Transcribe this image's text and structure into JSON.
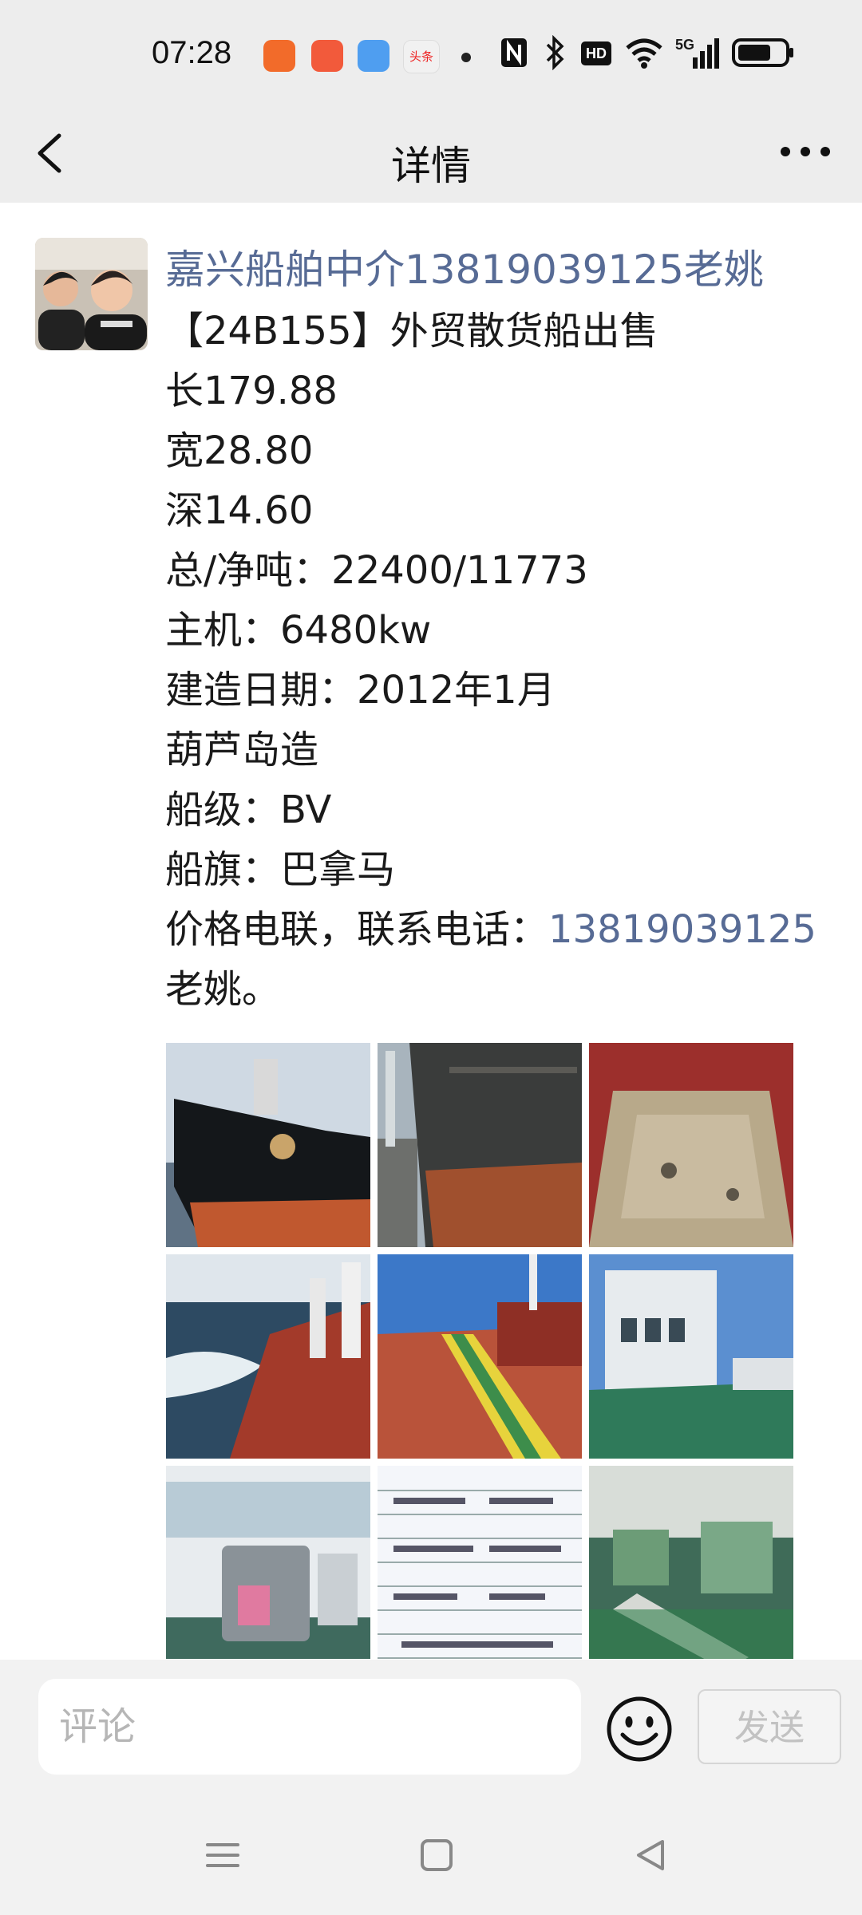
{
  "status_bar": {
    "time": "07:28",
    "badge_text": "头条",
    "network": "5G",
    "hd": "HD",
    "icons": [
      "app-icon-orange",
      "app-icon-red",
      "weather-icon",
      "news-app-icon",
      "dot-icon",
      "nfc-icon",
      "bluetooth-icon",
      "hd-icon",
      "wifi-icon",
      "signal-5g-icon",
      "battery-icon"
    ]
  },
  "nav": {
    "title": "详情",
    "back_icon": "back-chevron-icon",
    "more_icon": "more-dots-icon"
  },
  "post": {
    "author": "嘉兴船舶中介13819039125老姚",
    "lines": [
      "【24B155】外贸散货船出售",
      "长179.88",
      "宽28.80",
      "深14.60",
      "总/净吨：22400/11773",
      "主机：6480kw",
      "建造日期：2012年1月",
      "葫芦岛造",
      "船级：BV",
      "船旗：巴拿马"
    ],
    "contact_prefix": "价格电联，联系电话：",
    "contact_phone": "13819039125",
    "contact_suffix": "老姚。",
    "photos": [
      "ship-bow-photo",
      "ship-hull-side-photo",
      "cargo-hold-photo",
      "ship-at-sea-photo",
      "deck-walkway-photo",
      "superstructure-deck-photo",
      "bridge-interior-photo",
      "ship-particulars-sheet-photo",
      "engine-room-photo"
    ]
  },
  "comment_bar": {
    "placeholder": "评论",
    "emoji_icon": "emoji-smile-icon",
    "send_label": "发送"
  },
  "system_nav": {
    "icons": [
      "menu-icon",
      "home-square-icon",
      "back-triangle-icon"
    ]
  },
  "colors": {
    "link": "#576b95",
    "bar_bg": "#ededed",
    "text": "#1a1a1a"
  }
}
